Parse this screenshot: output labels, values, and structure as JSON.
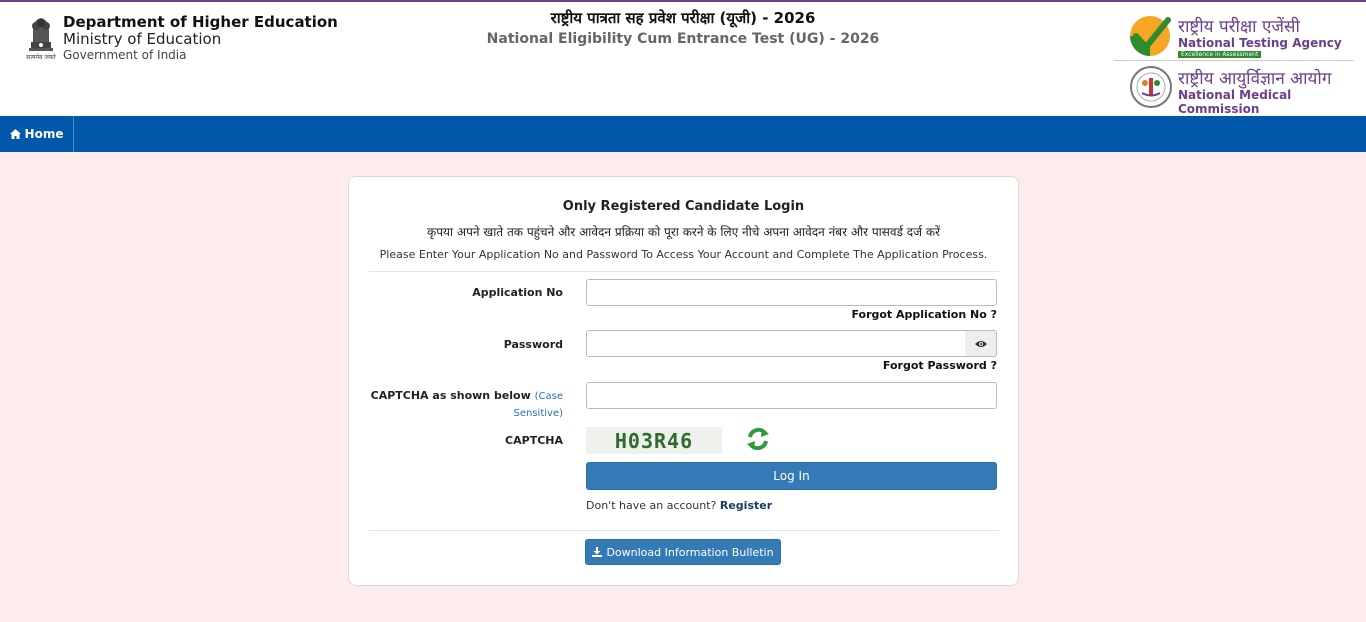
{
  "header": {
    "dept_line1": "Department of Higher Education",
    "dept_line2": "Ministry of Education",
    "dept_line3": "Government of India",
    "emblem_caption": "सत्यमेव जयते",
    "title_hi": "राष्ट्रीय पात्रता सह प्रवेश परीक्षा (यूजी) - 2026",
    "title_en": "National Eligibility Cum Entrance Test (UG) - 2026",
    "nta_hi": "राष्ट्रीय परीक्षा एजेंसी",
    "nta_en": "National Testing Agency",
    "nta_tagline": "Excellence in Assessment",
    "nmc_hi": "राष्ट्रीय आयुर्विज्ञान आयोग",
    "nmc_en": "National Medical Commission"
  },
  "nav": {
    "home_label": "Home"
  },
  "login": {
    "title": "Only Registered Candidate Login",
    "instruction_hi": "कृपया अपने खाते तक पहुंचने और आवेदन प्रक्रिया को पूरा करने के लिए नीचे अपना आवेदन नंबर और पासवर्ड दर्ज करें",
    "instruction_en": "Please Enter Your Application No and Password To Access Your Account and Complete The Application Process.",
    "app_no_label": "Application No",
    "app_no_value": "",
    "forgot_app_no": "Forgot Application No ?",
    "password_label": "Password",
    "password_value": "",
    "forgot_password": "Forgot Password ?",
    "captcha_input_label": "CAPTCHA as shown below",
    "captcha_case_note": "(Case Sensitive)",
    "captcha_value": "",
    "captcha_label": "CAPTCHA",
    "captcha_text": "H03R46",
    "login_button": "Log In",
    "no_account_text": "Don't have an account?",
    "register_link": "Register",
    "bulletin_button": "Download Information Bulletin"
  },
  "colors": {
    "nav_bar": "#0058aa",
    "button": "#337ab7",
    "page_bg": "#fdeceb",
    "brand_purple": "#6b3f8c"
  },
  "icons": {
    "home": "home-icon",
    "eye": "eye-icon",
    "refresh": "refresh-icon",
    "download": "download-icon"
  }
}
